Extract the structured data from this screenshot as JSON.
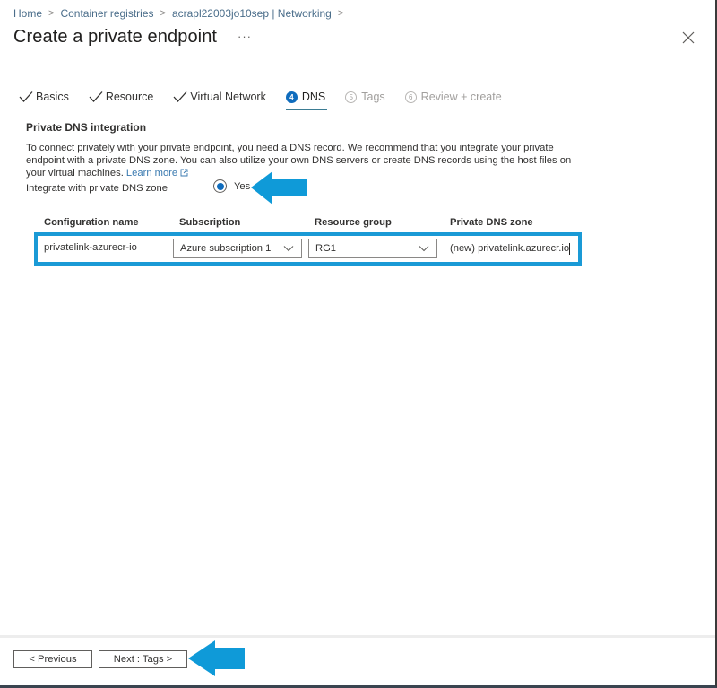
{
  "breadcrumb": {
    "items": [
      "Home",
      "Container registries",
      "acrapl22003jo10sep | Networking"
    ],
    "separator": ">"
  },
  "header": {
    "title": "Create a private endpoint",
    "more_label": "···",
    "close_icon": "close-icon"
  },
  "tabs": [
    {
      "label": "Basics",
      "state": "done",
      "icon": "checkmark-icon"
    },
    {
      "label": "Resource",
      "state": "done",
      "icon": "checkmark-icon"
    },
    {
      "label": "Virtual Network",
      "state": "done",
      "icon": "checkmark-icon"
    },
    {
      "label": "DNS",
      "state": "active",
      "number": "4"
    },
    {
      "label": "Tags",
      "state": "disabled",
      "number": "5"
    },
    {
      "label": "Review + create",
      "state": "disabled",
      "number": "6"
    }
  ],
  "dns": {
    "section_title": "Private DNS integration",
    "description": "To connect privately with your private endpoint, you need a DNS record. We recommend that you integrate your private endpoint with a private DNS zone. You can also utilize your own DNS servers or create DNS records using the host files on your virtual machines.",
    "learn_more": "Learn more",
    "integrate_label": "Integrate with private DNS zone",
    "integrate_option": "Yes",
    "integrate_selected": true,
    "columns": [
      "Configuration name",
      "Subscription",
      "Resource group",
      "Private DNS zone"
    ],
    "row": {
      "configuration_name": "privatelink-azurecr-io",
      "subscription": "Azure subscription 1",
      "resource_group": "RG1",
      "private_dns_zone": "(new) privatelink.azurecr.io"
    }
  },
  "footer": {
    "previous_label": "< Previous",
    "next_label": "Next : Tags >"
  },
  "colors": {
    "accent": "#0f6cbd",
    "highlight": "#1a9ad6",
    "arrow": "#0f9ad8",
    "link": "#3a7ab0",
    "tab_underline": "#3b7c93"
  }
}
